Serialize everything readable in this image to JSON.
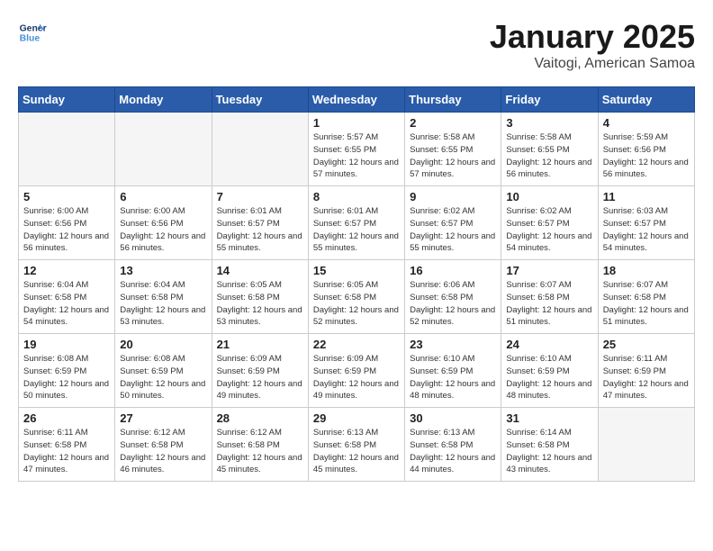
{
  "header": {
    "logo_line1": "General",
    "logo_line2": "Blue",
    "month": "January 2025",
    "location": "Vaitogi, American Samoa"
  },
  "weekdays": [
    "Sunday",
    "Monday",
    "Tuesday",
    "Wednesday",
    "Thursday",
    "Friday",
    "Saturday"
  ],
  "weeks": [
    [
      {
        "day": "",
        "info": ""
      },
      {
        "day": "",
        "info": ""
      },
      {
        "day": "",
        "info": ""
      },
      {
        "day": "1",
        "info": "Sunrise: 5:57 AM\nSunset: 6:55 PM\nDaylight: 12 hours\nand 57 minutes."
      },
      {
        "day": "2",
        "info": "Sunrise: 5:58 AM\nSunset: 6:55 PM\nDaylight: 12 hours\nand 57 minutes."
      },
      {
        "day": "3",
        "info": "Sunrise: 5:58 AM\nSunset: 6:55 PM\nDaylight: 12 hours\nand 56 minutes."
      },
      {
        "day": "4",
        "info": "Sunrise: 5:59 AM\nSunset: 6:56 PM\nDaylight: 12 hours\nand 56 minutes."
      }
    ],
    [
      {
        "day": "5",
        "info": "Sunrise: 6:00 AM\nSunset: 6:56 PM\nDaylight: 12 hours\nand 56 minutes."
      },
      {
        "day": "6",
        "info": "Sunrise: 6:00 AM\nSunset: 6:56 PM\nDaylight: 12 hours\nand 56 minutes."
      },
      {
        "day": "7",
        "info": "Sunrise: 6:01 AM\nSunset: 6:57 PM\nDaylight: 12 hours\nand 55 minutes."
      },
      {
        "day": "8",
        "info": "Sunrise: 6:01 AM\nSunset: 6:57 PM\nDaylight: 12 hours\nand 55 minutes."
      },
      {
        "day": "9",
        "info": "Sunrise: 6:02 AM\nSunset: 6:57 PM\nDaylight: 12 hours\nand 55 minutes."
      },
      {
        "day": "10",
        "info": "Sunrise: 6:02 AM\nSunset: 6:57 PM\nDaylight: 12 hours\nand 54 minutes."
      },
      {
        "day": "11",
        "info": "Sunrise: 6:03 AM\nSunset: 6:57 PM\nDaylight: 12 hours\nand 54 minutes."
      }
    ],
    [
      {
        "day": "12",
        "info": "Sunrise: 6:04 AM\nSunset: 6:58 PM\nDaylight: 12 hours\nand 54 minutes."
      },
      {
        "day": "13",
        "info": "Sunrise: 6:04 AM\nSunset: 6:58 PM\nDaylight: 12 hours\nand 53 minutes."
      },
      {
        "day": "14",
        "info": "Sunrise: 6:05 AM\nSunset: 6:58 PM\nDaylight: 12 hours\nand 53 minutes."
      },
      {
        "day": "15",
        "info": "Sunrise: 6:05 AM\nSunset: 6:58 PM\nDaylight: 12 hours\nand 52 minutes."
      },
      {
        "day": "16",
        "info": "Sunrise: 6:06 AM\nSunset: 6:58 PM\nDaylight: 12 hours\nand 52 minutes."
      },
      {
        "day": "17",
        "info": "Sunrise: 6:07 AM\nSunset: 6:58 PM\nDaylight: 12 hours\nand 51 minutes."
      },
      {
        "day": "18",
        "info": "Sunrise: 6:07 AM\nSunset: 6:58 PM\nDaylight: 12 hours\nand 51 minutes."
      }
    ],
    [
      {
        "day": "19",
        "info": "Sunrise: 6:08 AM\nSunset: 6:59 PM\nDaylight: 12 hours\nand 50 minutes."
      },
      {
        "day": "20",
        "info": "Sunrise: 6:08 AM\nSunset: 6:59 PM\nDaylight: 12 hours\nand 50 minutes."
      },
      {
        "day": "21",
        "info": "Sunrise: 6:09 AM\nSunset: 6:59 PM\nDaylight: 12 hours\nand 49 minutes."
      },
      {
        "day": "22",
        "info": "Sunrise: 6:09 AM\nSunset: 6:59 PM\nDaylight: 12 hours\nand 49 minutes."
      },
      {
        "day": "23",
        "info": "Sunrise: 6:10 AM\nSunset: 6:59 PM\nDaylight: 12 hours\nand 48 minutes."
      },
      {
        "day": "24",
        "info": "Sunrise: 6:10 AM\nSunset: 6:59 PM\nDaylight: 12 hours\nand 48 minutes."
      },
      {
        "day": "25",
        "info": "Sunrise: 6:11 AM\nSunset: 6:59 PM\nDaylight: 12 hours\nand 47 minutes."
      }
    ],
    [
      {
        "day": "26",
        "info": "Sunrise: 6:11 AM\nSunset: 6:58 PM\nDaylight: 12 hours\nand 47 minutes."
      },
      {
        "day": "27",
        "info": "Sunrise: 6:12 AM\nSunset: 6:58 PM\nDaylight: 12 hours\nand 46 minutes."
      },
      {
        "day": "28",
        "info": "Sunrise: 6:12 AM\nSunset: 6:58 PM\nDaylight: 12 hours\nand 45 minutes."
      },
      {
        "day": "29",
        "info": "Sunrise: 6:13 AM\nSunset: 6:58 PM\nDaylight: 12 hours\nand 45 minutes."
      },
      {
        "day": "30",
        "info": "Sunrise: 6:13 AM\nSunset: 6:58 PM\nDaylight: 12 hours\nand 44 minutes."
      },
      {
        "day": "31",
        "info": "Sunrise: 6:14 AM\nSunset: 6:58 PM\nDaylight: 12 hours\nand 43 minutes."
      },
      {
        "day": "",
        "info": ""
      }
    ]
  ]
}
